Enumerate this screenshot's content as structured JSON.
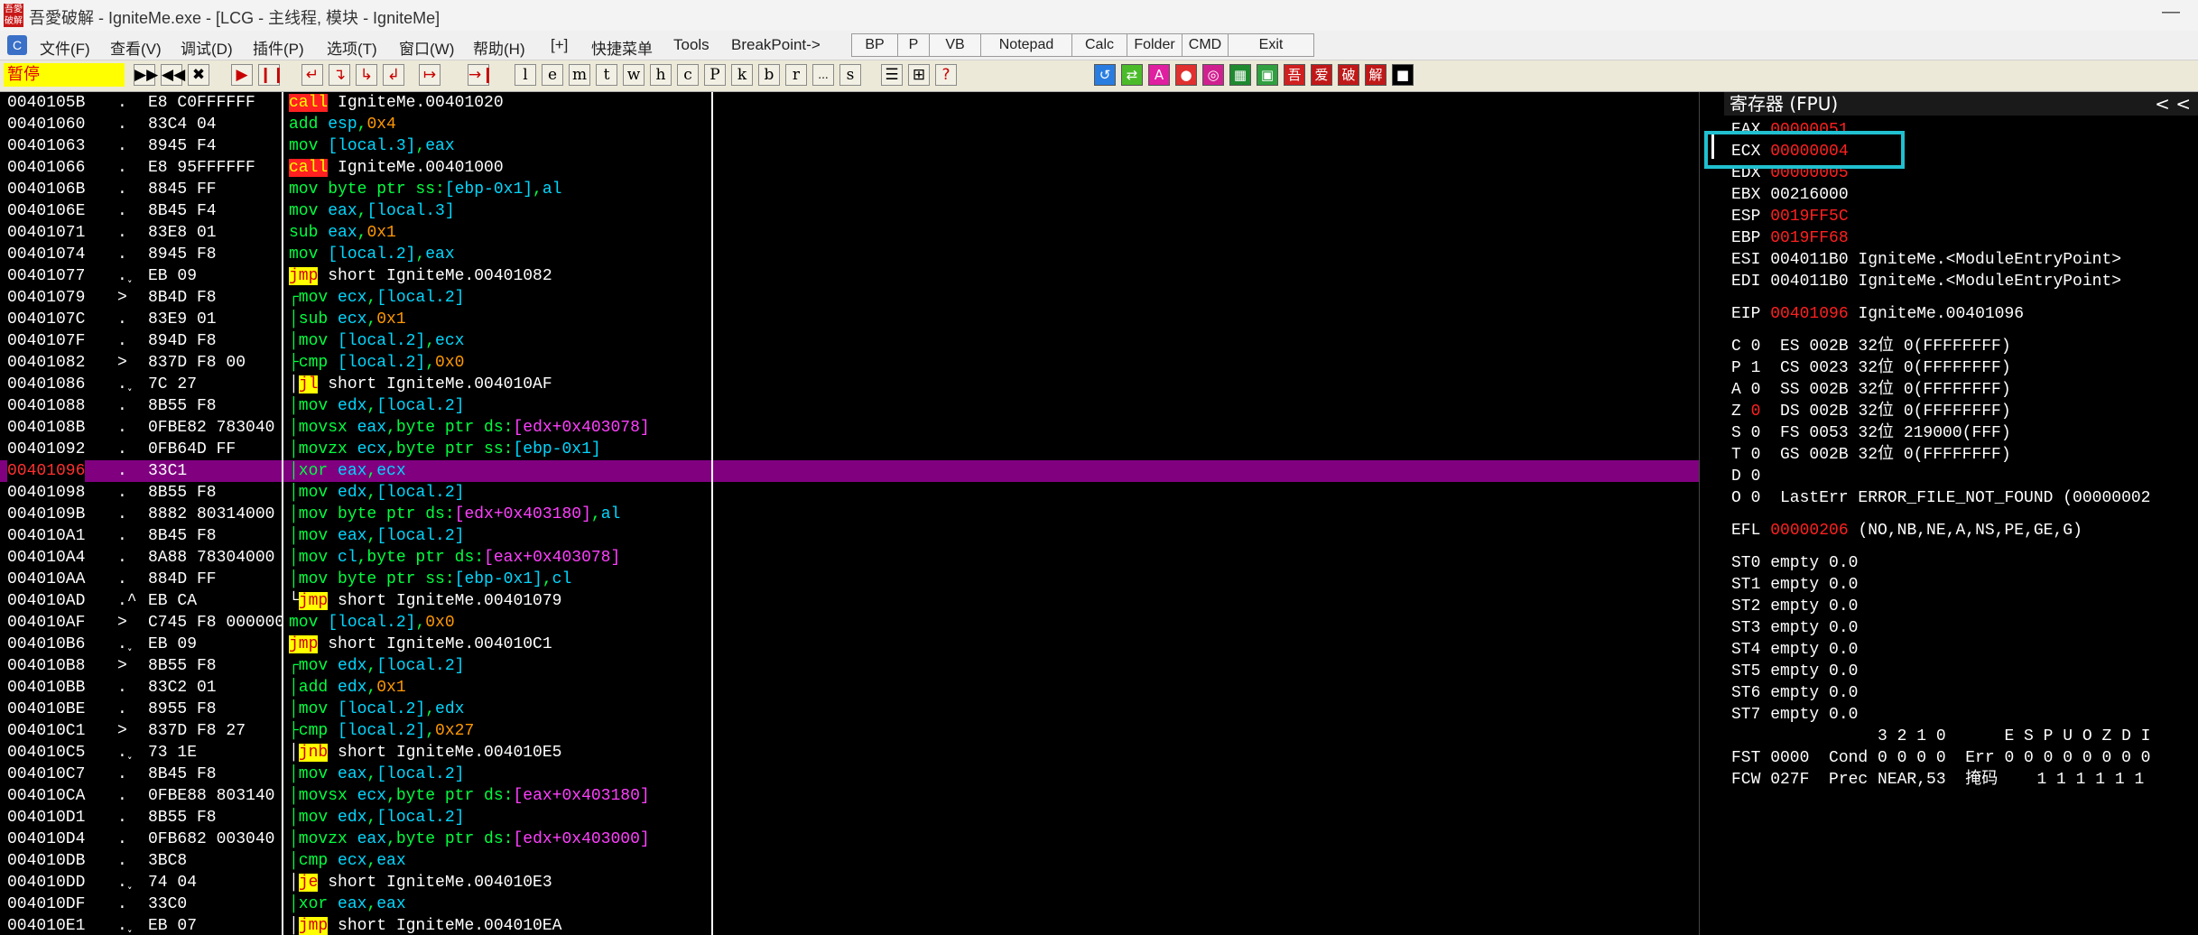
{
  "window": {
    "title": "吾愛破解 - IgniteMe.exe - [LCG - 主线程, 模块 - IgniteMe]",
    "app_icon_text": "吾愛破解",
    "minimize_glyph": "—"
  },
  "menu": {
    "items": [
      "文件(F)",
      "查看(V)",
      "调试(D)",
      "插件(P)",
      "选项(T)",
      "窗口(W)",
      "帮助(H)",
      "[+]",
      "快捷菜单",
      "Tools",
      "BreakPoint->"
    ],
    "buttons": [
      "BP",
      "P",
      "VB",
      "Notepad",
      "Calc",
      "Folder",
      "CMD",
      "Exit"
    ]
  },
  "toolbar": {
    "status": "暂停",
    "tools": [
      "▶▶",
      "◀◀",
      "✖",
      "▶",
      "❙❙",
      "↵",
      "↴",
      "↳",
      "↲",
      "↦",
      "→❙"
    ],
    "letters": [
      "l",
      "e",
      "m",
      "t",
      "w",
      "h",
      "c",
      "P",
      "k",
      "b",
      "r",
      "...",
      "s"
    ],
    "extra": [
      "☰",
      "⊞",
      "?"
    ],
    "plugins": [
      "↺",
      "⇄",
      "A",
      "●",
      "◎",
      "▦",
      "▣",
      "吾",
      "爱",
      "破",
      "解",
      "■"
    ]
  },
  "disassembly": [
    {
      "addr": "0040105B",
      "flow": ".",
      "hex": "E8 C0FFFFFF",
      "parts": [
        [
          "call",
          "op-call"
        ],
        [
          " IgniteMe.00401020",
          "c-white"
        ]
      ]
    },
    {
      "addr": "00401060",
      "flow": ".",
      "hex": "83C4 04",
      "parts": [
        [
          "add ",
          "c-green"
        ],
        [
          "esp",
          "c-cyan"
        ],
        [
          ",",
          "c-green"
        ],
        [
          "0x4",
          "c-orange"
        ]
      ]
    },
    {
      "addr": "00401063",
      "flow": ".",
      "hex": "8945 F4",
      "parts": [
        [
          "mov ",
          "c-green"
        ],
        [
          "[local.3]",
          "c-cyan"
        ],
        [
          ",",
          "c-green"
        ],
        [
          "eax",
          "c-cyan"
        ]
      ]
    },
    {
      "addr": "00401066",
      "flow": ".",
      "hex": "E8 95FFFFFF",
      "parts": [
        [
          "call",
          "op-call"
        ],
        [
          " IgniteMe.00401000",
          "c-white"
        ]
      ]
    },
    {
      "addr": "0040106B",
      "flow": ".",
      "hex": "8845 FF",
      "parts": [
        [
          "mov byte ptr ss:",
          "c-green"
        ],
        [
          "[ebp-0x1]",
          "c-cyan"
        ],
        [
          ",",
          "c-green"
        ],
        [
          "al",
          "c-cyan"
        ]
      ]
    },
    {
      "addr": "0040106E",
      "flow": ".",
      "hex": "8B45 F4",
      "parts": [
        [
          "mov ",
          "c-green"
        ],
        [
          "eax",
          "c-cyan"
        ],
        [
          ",",
          "c-green"
        ],
        [
          "[local.3]",
          "c-cyan"
        ]
      ]
    },
    {
      "addr": "00401071",
      "flow": ".",
      "hex": "83E8 01",
      "parts": [
        [
          "sub ",
          "c-green"
        ],
        [
          "eax",
          "c-cyan"
        ],
        [
          ",",
          "c-green"
        ],
        [
          "0x1",
          "c-orange"
        ]
      ]
    },
    {
      "addr": "00401074",
      "flow": ".",
      "hex": "8945 F8",
      "parts": [
        [
          "mov ",
          "c-green"
        ],
        [
          "[local.2]",
          "c-cyan"
        ],
        [
          ",",
          "c-green"
        ],
        [
          "eax",
          "c-cyan"
        ]
      ]
    },
    {
      "addr": "00401077",
      "flow": ".˯",
      "hex": "EB 09",
      "parts": [
        [
          "jmp",
          "op-jmp"
        ],
        [
          " short IgniteMe.00401082",
          "c-white"
        ]
      ]
    },
    {
      "addr": "00401079",
      "flow": ">",
      "hex": "8B4D F8",
      "parts": [
        [
          "┌mov ",
          "c-green"
        ],
        [
          "ecx",
          "c-cyan"
        ],
        [
          ",",
          "c-green"
        ],
        [
          "[local.2]",
          "c-cyan"
        ]
      ]
    },
    {
      "addr": "0040107C",
      "flow": ".",
      "hex": "83E9 01",
      "parts": [
        [
          "│sub ",
          "c-green"
        ],
        [
          "ecx",
          "c-cyan"
        ],
        [
          ",",
          "c-green"
        ],
        [
          "0x1",
          "c-orange"
        ]
      ]
    },
    {
      "addr": "0040107F",
      "flow": ".",
      "hex": "894D F8",
      "parts": [
        [
          "│mov ",
          "c-green"
        ],
        [
          "[local.2]",
          "c-cyan"
        ],
        [
          ",",
          "c-green"
        ],
        [
          "ecx",
          "c-cyan"
        ]
      ]
    },
    {
      "addr": "00401082",
      "flow": ">",
      "hex": "837D F8 00",
      "parts": [
        [
          "├cmp ",
          "c-green"
        ],
        [
          "[local.2]",
          "c-cyan"
        ],
        [
          ",",
          "c-green"
        ],
        [
          "0x0",
          "c-orange"
        ]
      ]
    },
    {
      "addr": "00401086",
      "flow": ".˯",
      "hex": "7C 27",
      "parts": [
        [
          "│",
          "c-white"
        ],
        [
          "jl",
          "op-jmp"
        ],
        [
          " short IgniteMe.004010AF",
          "c-white"
        ]
      ]
    },
    {
      "addr": "00401088",
      "flow": ".",
      "hex": "8B55 F8",
      "parts": [
        [
          "│mov ",
          "c-green"
        ],
        [
          "edx",
          "c-cyan"
        ],
        [
          ",",
          "c-green"
        ],
        [
          "[local.2]",
          "c-cyan"
        ]
      ]
    },
    {
      "addr": "0040108B",
      "flow": ".",
      "hex": "0FBE82 783040",
      "parts": [
        [
          "│movsx ",
          "c-green"
        ],
        [
          "eax",
          "c-cyan"
        ],
        [
          ",byte ptr ds:",
          "c-green"
        ],
        [
          "[edx+0x403078]",
          "c-mag"
        ]
      ]
    },
    {
      "addr": "00401092",
      "flow": ".",
      "hex": "0FB64D FF",
      "parts": [
        [
          "│movzx ",
          "c-green"
        ],
        [
          "ecx",
          "c-cyan"
        ],
        [
          ",byte ptr ss:",
          "c-green"
        ],
        [
          "[ebp-0x1]",
          "c-cyan"
        ]
      ]
    },
    {
      "addr": "00401096",
      "flow": ".",
      "hex": "33C1",
      "selected": true,
      "parts": [
        [
          "│xor ",
          "c-green"
        ],
        [
          "eax",
          "c-cyan"
        ],
        [
          ",",
          "c-green"
        ],
        [
          "ecx",
          "c-cyan"
        ]
      ]
    },
    {
      "addr": "00401098",
      "flow": ".",
      "hex": "8B55 F8",
      "parts": [
        [
          "│mov ",
          "c-green"
        ],
        [
          "edx",
          "c-cyan"
        ],
        [
          ",",
          "c-green"
        ],
        [
          "[local.2]",
          "c-cyan"
        ]
      ]
    },
    {
      "addr": "0040109B",
      "flow": ".",
      "hex": "8882 80314000",
      "parts": [
        [
          "│mov byte ptr ds:",
          "c-green"
        ],
        [
          "[edx+0x403180]",
          "c-mag"
        ],
        [
          ",",
          "c-green"
        ],
        [
          "al",
          "c-cyan"
        ]
      ]
    },
    {
      "addr": "004010A1",
      "flow": ".",
      "hex": "8B45 F8",
      "parts": [
        [
          "│mov ",
          "c-green"
        ],
        [
          "eax",
          "c-cyan"
        ],
        [
          ",",
          "c-green"
        ],
        [
          "[local.2]",
          "c-cyan"
        ]
      ]
    },
    {
      "addr": "004010A4",
      "flow": ".",
      "hex": "8A88 78304000",
      "parts": [
        [
          "│mov ",
          "c-green"
        ],
        [
          "cl",
          "c-cyan"
        ],
        [
          ",byte ptr ds:",
          "c-green"
        ],
        [
          "[eax+0x403078]",
          "c-mag"
        ]
      ]
    },
    {
      "addr": "004010AA",
      "flow": ".",
      "hex": "884D FF",
      "parts": [
        [
          "│mov byte ptr ss:",
          "c-green"
        ],
        [
          "[ebp-0x1]",
          "c-cyan"
        ],
        [
          ",",
          "c-green"
        ],
        [
          "cl",
          "c-cyan"
        ]
      ]
    },
    {
      "addr": "004010AD",
      "flow": ".^",
      "hex": "EB CA",
      "parts": [
        [
          "└",
          "c-white"
        ],
        [
          "jmp",
          "op-jmp"
        ],
        [
          " short IgniteMe.00401079",
          "c-white"
        ]
      ]
    },
    {
      "addr": "004010AF",
      "flow": ">",
      "hex": "C745 F8 000000",
      "parts": [
        [
          "mov ",
          "c-green"
        ],
        [
          "[local.2]",
          "c-cyan"
        ],
        [
          ",",
          "c-green"
        ],
        [
          "0x0",
          "c-orange"
        ]
      ]
    },
    {
      "addr": "004010B6",
      "flow": ".˯",
      "hex": "EB 09",
      "parts": [
        [
          "jmp",
          "op-jmp"
        ],
        [
          " short IgniteMe.004010C1",
          "c-white"
        ]
      ]
    },
    {
      "addr": "004010B8",
      "flow": ">",
      "hex": "8B55 F8",
      "parts": [
        [
          "┌mov ",
          "c-green"
        ],
        [
          "edx",
          "c-cyan"
        ],
        [
          ",",
          "c-green"
        ],
        [
          "[local.2]",
          "c-cyan"
        ]
      ]
    },
    {
      "addr": "004010BB",
      "flow": ".",
      "hex": "83C2 01",
      "parts": [
        [
          "│add ",
          "c-green"
        ],
        [
          "edx",
          "c-cyan"
        ],
        [
          ",",
          "c-green"
        ],
        [
          "0x1",
          "c-orange"
        ]
      ]
    },
    {
      "addr": "004010BE",
      "flow": ".",
      "hex": "8955 F8",
      "parts": [
        [
          "│mov ",
          "c-green"
        ],
        [
          "[local.2]",
          "c-cyan"
        ],
        [
          ",",
          "c-green"
        ],
        [
          "edx",
          "c-cyan"
        ]
      ]
    },
    {
      "addr": "004010C1",
      "flow": ">",
      "hex": "837D F8 27",
      "parts": [
        [
          "├cmp ",
          "c-green"
        ],
        [
          "[local.2]",
          "c-cyan"
        ],
        [
          ",",
          "c-green"
        ],
        [
          "0x27",
          "c-orange"
        ]
      ]
    },
    {
      "addr": "004010C5",
      "flow": ".˯",
      "hex": "73 1E",
      "parts": [
        [
          "│",
          "c-white"
        ],
        [
          "jnb",
          "op-jmp"
        ],
        [
          " short IgniteMe.004010E5",
          "c-white"
        ]
      ]
    },
    {
      "addr": "004010C7",
      "flow": ".",
      "hex": "8B45 F8",
      "parts": [
        [
          "│mov ",
          "c-green"
        ],
        [
          "eax",
          "c-cyan"
        ],
        [
          ",",
          "c-green"
        ],
        [
          "[local.2]",
          "c-cyan"
        ]
      ]
    },
    {
      "addr": "004010CA",
      "flow": ".",
      "hex": "0FBE88 803140",
      "parts": [
        [
          "│movsx ",
          "c-green"
        ],
        [
          "ecx",
          "c-cyan"
        ],
        [
          ",byte ptr ds:",
          "c-green"
        ],
        [
          "[eax+0x403180]",
          "c-mag"
        ]
      ]
    },
    {
      "addr": "004010D1",
      "flow": ".",
      "hex": "8B55 F8",
      "parts": [
        [
          "│mov ",
          "c-green"
        ],
        [
          "edx",
          "c-cyan"
        ],
        [
          ",",
          "c-green"
        ],
        [
          "[local.2]",
          "c-cyan"
        ]
      ]
    },
    {
      "addr": "004010D4",
      "flow": ".",
      "hex": "0FB682 003040",
      "parts": [
        [
          "│movzx ",
          "c-green"
        ],
        [
          "eax",
          "c-cyan"
        ],
        [
          ",byte ptr ds:",
          "c-green"
        ],
        [
          "[edx+0x403000]",
          "c-mag"
        ]
      ]
    },
    {
      "addr": "004010DB",
      "flow": ".",
      "hex": "3BC8",
      "parts": [
        [
          "│cmp ",
          "c-green"
        ],
        [
          "ecx",
          "c-cyan"
        ],
        [
          ",",
          "c-green"
        ],
        [
          "eax",
          "c-cyan"
        ]
      ]
    },
    {
      "addr": "004010DD",
      "flow": ".˯",
      "hex": "74 04",
      "parts": [
        [
          "│",
          "c-white"
        ],
        [
          "je",
          "op-jmp"
        ],
        [
          " short IgniteMe.004010E3",
          "c-white"
        ]
      ]
    },
    {
      "addr": "004010DF",
      "flow": ".",
      "hex": "33C0",
      "parts": [
        [
          "│xor ",
          "c-green"
        ],
        [
          "eax",
          "c-cyan"
        ],
        [
          ",",
          "c-green"
        ],
        [
          "eax",
          "c-cyan"
        ]
      ]
    },
    {
      "addr": "004010E1",
      "flow": ".˯",
      "hex": "EB 07",
      "parts": [
        [
          "│",
          "c-white"
        ],
        [
          "jmp",
          "op-jmp"
        ],
        [
          " short IgniteMe.004010EA",
          "c-white"
        ]
      ]
    }
  ],
  "registers": {
    "title": "寄存器 (FPU)",
    "arrows": "<  <",
    "lines": [
      [
        [
          "EAX ",
          "c-white"
        ],
        [
          "00000051",
          "red"
        ]
      ],
      [
        [
          "ECX ",
          "c-white"
        ],
        [
          "00000004",
          "red"
        ]
      ],
      [
        [
          "EDX ",
          "c-white"
        ],
        [
          "00000005",
          "red"
        ]
      ],
      [
        [
          "EBX 00216000",
          "c-white"
        ]
      ],
      [
        [
          "ESP ",
          "c-white"
        ],
        [
          "0019FF5C",
          "red"
        ]
      ],
      [
        [
          "EBP ",
          "c-white"
        ],
        [
          "0019FF68",
          "red"
        ]
      ],
      [
        [
          "ESI 004011B0 IgniteMe.<ModuleEntryPoint>",
          "c-white"
        ]
      ],
      [
        [
          "EDI 004011B0 IgniteMe.<ModuleEntryPoint>",
          "c-white"
        ]
      ],
      [
        [
          "",
          "c-white"
        ]
      ],
      [
        [
          "EIP ",
          "c-white"
        ],
        [
          "00401096",
          "red"
        ],
        [
          " IgniteMe.00401096",
          "c-white"
        ]
      ],
      [
        [
          "",
          "c-white"
        ]
      ],
      [
        [
          "C 0  ES 002B 32位 0(FFFFFFFF)",
          "c-white"
        ]
      ],
      [
        [
          "P 1  CS 0023 32位 0(FFFFFFFF)",
          "c-white"
        ]
      ],
      [
        [
          "A 0  SS 002B 32位 0(FFFFFFFF)",
          "c-white"
        ]
      ],
      [
        [
          "Z ",
          "c-white"
        ],
        [
          "0",
          "red"
        ],
        [
          "  DS 002B 32位 0(FFFFFFFF)",
          "c-white"
        ]
      ],
      [
        [
          "S 0  FS 0053 32位 219000(FFF)",
          "c-white"
        ]
      ],
      [
        [
          "T 0  GS 002B 32位 0(FFFFFFFF)",
          "c-white"
        ]
      ],
      [
        [
          "D 0",
          "c-white"
        ]
      ],
      [
        [
          "O 0  LastErr ERROR_FILE_NOT_FOUND (00000002",
          "c-white"
        ]
      ],
      [
        [
          "",
          "c-white"
        ]
      ],
      [
        [
          "EFL ",
          "c-white"
        ],
        [
          "00000206",
          "red"
        ],
        [
          " (NO,NB,NE,A,NS,PE,GE,G)",
          "c-white"
        ]
      ],
      [
        [
          "",
          "c-white"
        ]
      ],
      [
        [
          "ST0 empty 0.0",
          "c-white"
        ]
      ],
      [
        [
          "ST1 empty 0.0",
          "c-white"
        ]
      ],
      [
        [
          "ST2 empty 0.0",
          "c-white"
        ]
      ],
      [
        [
          "ST3 empty 0.0",
          "c-white"
        ]
      ],
      [
        [
          "ST4 empty 0.0",
          "c-white"
        ]
      ],
      [
        [
          "ST5 empty 0.0",
          "c-white"
        ]
      ],
      [
        [
          "ST6 empty 0.0",
          "c-white"
        ]
      ],
      [
        [
          "ST7 empty 0.0",
          "c-white"
        ]
      ],
      [
        [
          "               3 2 1 0      E S P U O Z D I",
          "c-white"
        ]
      ],
      [
        [
          "FST 0000  Cond 0 0 0 0  Err 0 0 0 0 0 0 0 0",
          "c-white"
        ]
      ],
      [
        [
          "FCW 027F  Prec NEAR,53  掩码    1 1 1 1 1 1",
          "c-white"
        ]
      ]
    ]
  }
}
